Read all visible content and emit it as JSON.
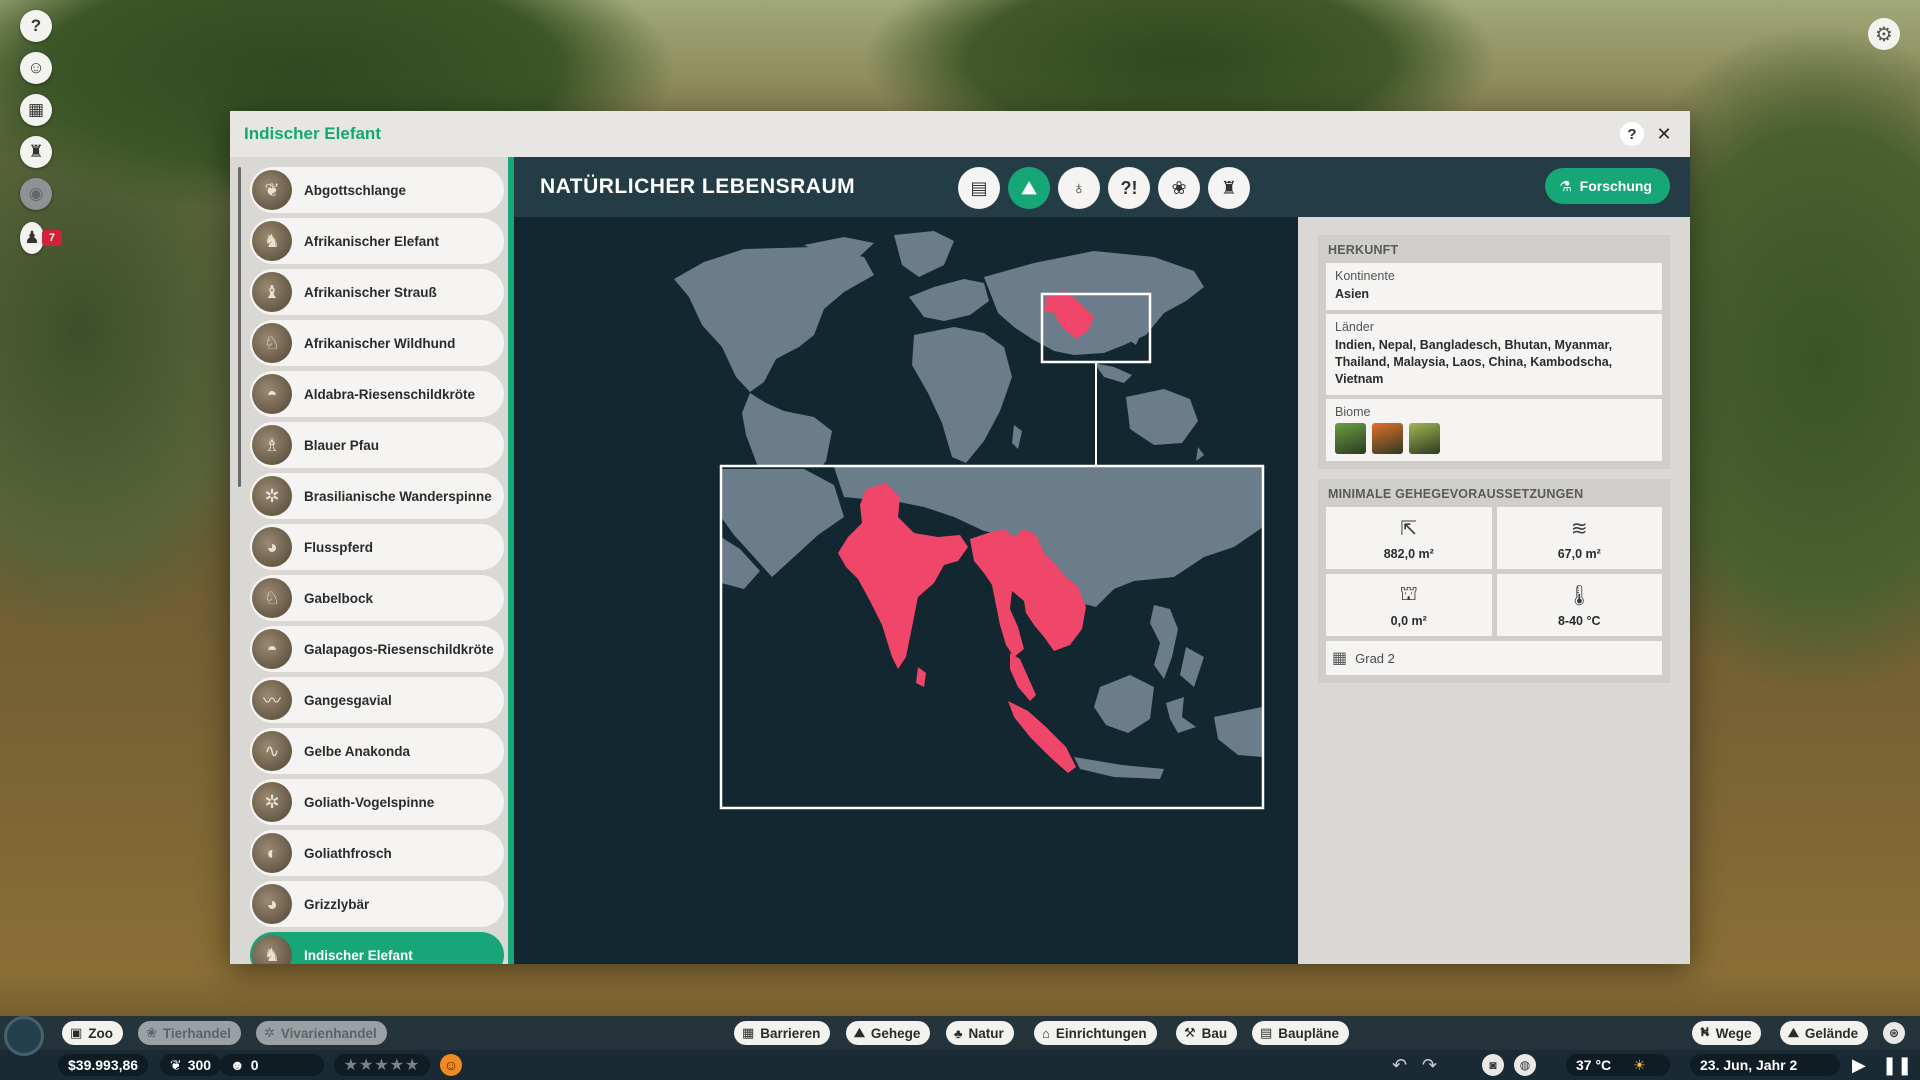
{
  "hud": {
    "left_icons": [
      "help-icon",
      "animal-status-icon",
      "calendar-icon",
      "trophy-icon",
      "eye-icon",
      "staff-icon"
    ],
    "notification_count": "7",
    "settings_icon": "gear-icon"
  },
  "window": {
    "title": "Indischer Elefant",
    "help_label": "?",
    "close_label": "✕"
  },
  "animals": [
    {
      "name": "Abgottschlange",
      "selected": false
    },
    {
      "name": "Afrikanischer Elefant",
      "selected": false
    },
    {
      "name": "Afrikanischer Strauß",
      "selected": false
    },
    {
      "name": "Afrikanischer Wildhund",
      "selected": false
    },
    {
      "name": "Aldabra-Riesenschildkröte",
      "selected": false
    },
    {
      "name": "Blauer Pfau",
      "selected": false
    },
    {
      "name": "Brasilianische Wanderspinne",
      "selected": false
    },
    {
      "name": "Flusspferd",
      "selected": false
    },
    {
      "name": "Gabelbock",
      "selected": false
    },
    {
      "name": "Galapagos-Riesenschildkröte",
      "selected": false
    },
    {
      "name": "Gangesgavial",
      "selected": false
    },
    {
      "name": "Gelbe Anakonda",
      "selected": false
    },
    {
      "name": "Goliath-Vogelspinne",
      "selected": false
    },
    {
      "name": "Goliathfrosch",
      "selected": false
    },
    {
      "name": "Grizzlybär",
      "selected": false
    },
    {
      "name": "Indischer Elefant",
      "selected": true
    }
  ],
  "content": {
    "section_title": "NATÜRLICHER LEBENSRAUM",
    "tabs": [
      "summary-icon",
      "habitat-icon",
      "water-icon",
      "behaviour-icon",
      "paw-icon",
      "trophy-icon"
    ],
    "active_tab": 1,
    "research_label": "Forschung"
  },
  "origin": {
    "title": "HERKUNFT",
    "continents_label": "Kontinente",
    "continents_value": "Asien",
    "countries_label": "Länder",
    "countries_value": "Indien, Nepal, Bangladesch, Bhutan, Myanmar, Thailand, Malaysia, Laos, China, Kambodscha, Vietnam",
    "biomes_label": "Biome",
    "biome_colors": [
      "#6aa040",
      "#e2702a",
      "#a2b850"
    ]
  },
  "requirements": {
    "title": "MINIMALE GEHEGEVORAUSSETZUNGEN",
    "land_area": "882,0 m²",
    "water_area": "67,0 m²",
    "climbing_area": "0,0 m²",
    "temperature": "8-40 °C",
    "barrier_grade": "Grad 2"
  },
  "toolbar": {
    "left_tabs": [
      {
        "label": "Zoo",
        "icon": "zoo-icon",
        "enabled": true
      },
      {
        "label": "Tierhandel",
        "icon": "paw-icon",
        "enabled": false
      },
      {
        "label": "Vivarienhandel",
        "icon": "bug-icon",
        "enabled": false
      }
    ],
    "build_tabs": [
      {
        "label": "Barrieren",
        "icon": "barrier-icon"
      },
      {
        "label": "Gehege",
        "icon": "habitat-icon"
      },
      {
        "label": "Natur",
        "icon": "tree-icon"
      },
      {
        "label": "Einrichtungen",
        "icon": "facility-icon"
      },
      {
        "label": "Bau",
        "icon": "build-icon"
      },
      {
        "label": "Baupläne",
        "icon": "blueprint-icon"
      }
    ],
    "right_tabs": [
      {
        "label": "Wege",
        "icon": "path-icon"
      },
      {
        "label": "Gelände",
        "icon": "terrain-icon"
      }
    ],
    "money": "$39.993,86",
    "conservation_credits": "300",
    "guests": "0",
    "rating_stars": 0,
    "temperature": "37 °C",
    "date": "23. Jun, Jahr 2"
  }
}
